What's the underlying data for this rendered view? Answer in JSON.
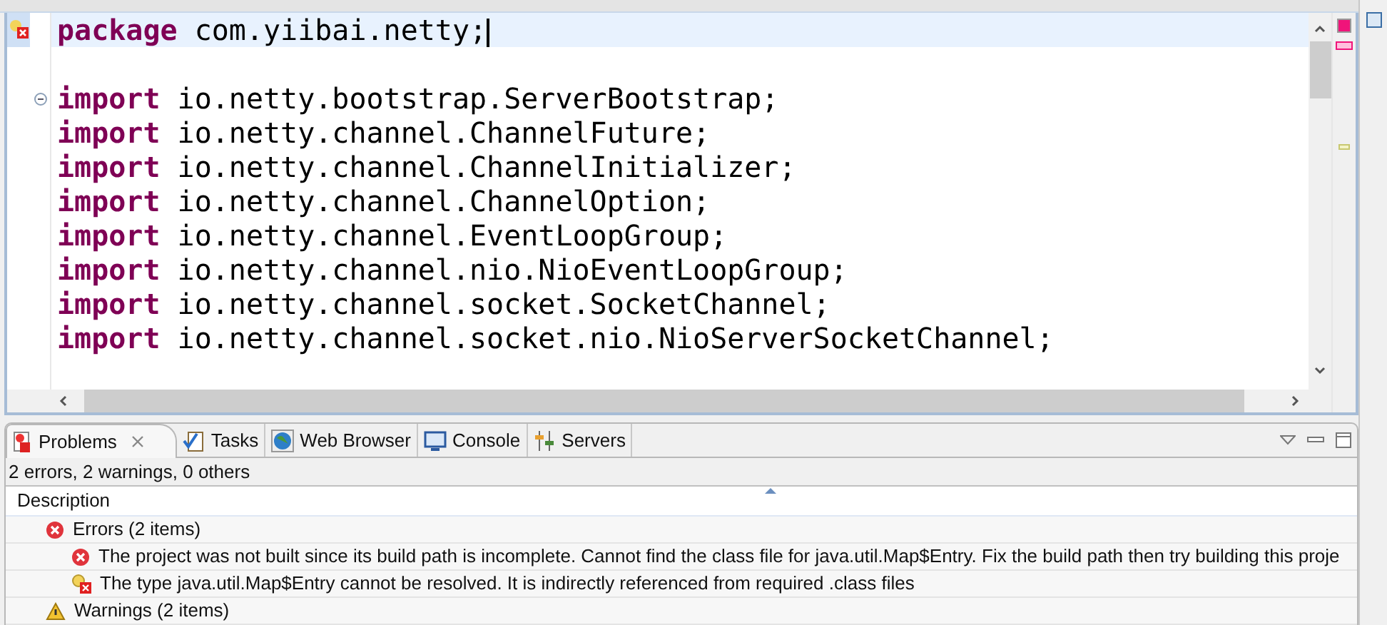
{
  "editor": {
    "lines": [
      {
        "kind": "error",
        "keyword": "package",
        "text": "com.yiibai.netty;",
        "current": true
      },
      {
        "kind": "blank",
        "current": false
      },
      {
        "kind": "foldable",
        "keyword": "import",
        "text": "io.netty.bootstrap.ServerBootstrap;",
        "current": false
      },
      {
        "keyword": "import",
        "text": "io.netty.channel.ChannelFuture;",
        "current": false
      },
      {
        "keyword": "import",
        "text": "io.netty.channel.ChannelInitializer;",
        "current": false
      },
      {
        "keyword": "import",
        "text": "io.netty.channel.ChannelOption;",
        "current": false
      },
      {
        "keyword": "import",
        "text": "io.netty.channel.EventLoopGroup;",
        "current": false
      },
      {
        "keyword": "import",
        "text": "io.netty.channel.nio.NioEventLoopGroup;",
        "current": false
      },
      {
        "keyword": "import",
        "text": "io.netty.channel.socket.SocketChannel;",
        "current": false
      },
      {
        "keyword": "import",
        "text": "io.netty.channel.socket.nio.NioServerSocketChannel;",
        "current": false
      }
    ]
  },
  "problems": {
    "tabs": [
      {
        "label": "Problems",
        "selected": true
      },
      {
        "label": "Tasks",
        "selected": false
      },
      {
        "label": "Web Browser",
        "selected": false
      },
      {
        "label": "Console",
        "selected": false
      },
      {
        "label": "Servers",
        "selected": false
      }
    ],
    "summary": "2 errors, 2 warnings, 0 others",
    "column": "Description",
    "groups": [
      {
        "kind": "error",
        "label": "Errors (2 items)",
        "children": [
          {
            "kind": "error",
            "text": "The project was not built since its build path is incomplete. Cannot find the class file for java.util.Map$Entry. Fix the build path then try building this proje"
          },
          {
            "kind": "error-fix",
            "text": "The type java.util.Map$Entry cannot be resolved. It is indirectly referenced from required .class files"
          }
        ]
      },
      {
        "kind": "warning",
        "label": "Warnings (2 items)"
      }
    ]
  }
}
